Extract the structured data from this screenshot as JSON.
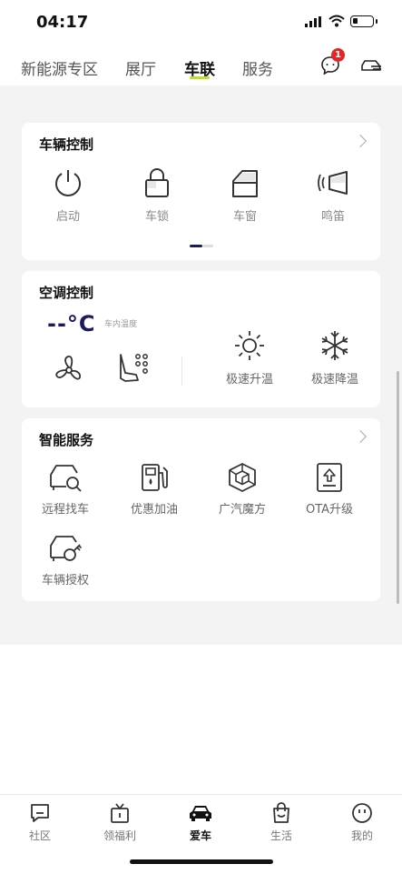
{
  "status_bar": {
    "time": "04:17"
  },
  "top_nav": {
    "tabs": [
      {
        "label": "新能源专区",
        "active": false
      },
      {
        "label": "展厅",
        "active": false
      },
      {
        "label": "车联",
        "active": true
      },
      {
        "label": "服务",
        "active": false
      }
    ],
    "message_badge": "1",
    "accent_color": "#c3dc2e",
    "icons": [
      "message-icon",
      "car-outline-icon"
    ]
  },
  "vehicle_control": {
    "title": "车辆控制",
    "items": [
      {
        "label": "启动",
        "icon": "power-icon"
      },
      {
        "label": "车锁",
        "icon": "lock-icon"
      },
      {
        "label": "车窗",
        "icon": "window-icon"
      },
      {
        "label": "鸣笛",
        "icon": "horn-icon"
      }
    ]
  },
  "ac_control": {
    "title": "空调控制",
    "temperature": "--°C",
    "temperature_caption": "车内温度",
    "quick_buttons": [
      {
        "label": "极速升温",
        "icon": "sun-icon"
      },
      {
        "label": "极速降温",
        "icon": "snowflake-icon"
      }
    ],
    "icons": [
      "fan-icon",
      "seat-heat-icon"
    ]
  },
  "smart_services": {
    "title": "智能服务",
    "items": [
      {
        "label": "远程找车",
        "icon": "find-car-icon"
      },
      {
        "label": "优惠加油",
        "icon": "fuel-icon"
      },
      {
        "label": "广汽魔方",
        "icon": "cube-icon"
      },
      {
        "label": "OTA升级",
        "icon": "ota-upgrade-icon"
      },
      {
        "label": "车辆授权",
        "icon": "car-key-icon"
      }
    ]
  },
  "bottom_tabs": [
    {
      "label": "社区",
      "icon": "community-icon",
      "active": false
    },
    {
      "label": "领福利",
      "icon": "gift-tv-icon",
      "active": false
    },
    {
      "label": "爱车",
      "icon": "car-filled-icon",
      "active": true
    },
    {
      "label": "生活",
      "icon": "shopping-bag-icon",
      "active": false
    },
    {
      "label": "我的",
      "icon": "face-icon",
      "active": false
    }
  ]
}
